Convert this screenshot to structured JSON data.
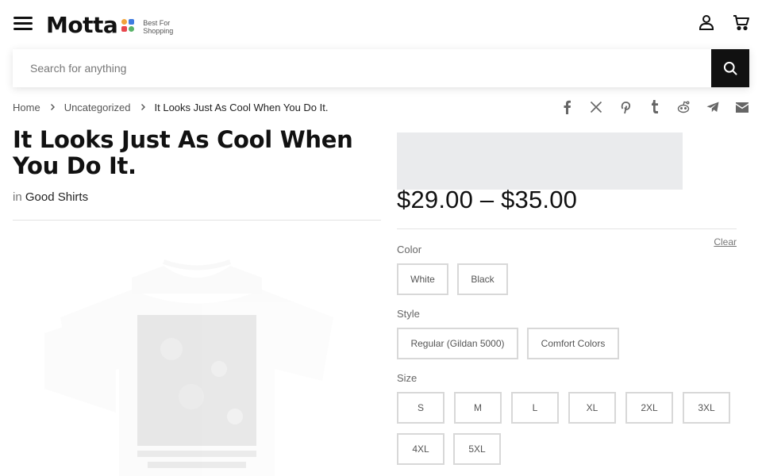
{
  "header": {
    "logo_text": "Motta",
    "logo_tagline_1": "Best For",
    "logo_tagline_2": "Shopping",
    "logo_colors": [
      "#f2a33a",
      "#3f7be0",
      "#e8474d",
      "#58b368"
    ]
  },
  "search": {
    "placeholder": "Search for anything",
    "value": ""
  },
  "breadcrumb": {
    "home": "Home",
    "category": "Uncategorized",
    "current": "It Looks Just As Cool When You Do It."
  },
  "share_icons": [
    "facebook-icon",
    "x-twitter-icon",
    "pinterest-icon",
    "tumblr-icon",
    "reddit-icon",
    "telegram-icon",
    "email-icon"
  ],
  "product": {
    "title": "It Looks Just As Cool When You Do It.",
    "category_prefix": "in",
    "category": "Good Shirts",
    "price_range": "$29.00 – $35.00"
  },
  "variations": {
    "clear_label": "Clear",
    "color_label": "Color",
    "colors": [
      "White",
      "Black"
    ],
    "style_label": "Style",
    "styles": [
      "Regular (Gildan 5000)",
      "Comfort Colors"
    ],
    "size_label": "Size",
    "sizes": [
      "S",
      "M",
      "L",
      "XL",
      "2XL",
      "3XL",
      "4XL",
      "5XL"
    ]
  },
  "colors": {
    "accent": "#111111",
    "border": "#d8d8d8",
    "placeholder": "#eaebed"
  }
}
